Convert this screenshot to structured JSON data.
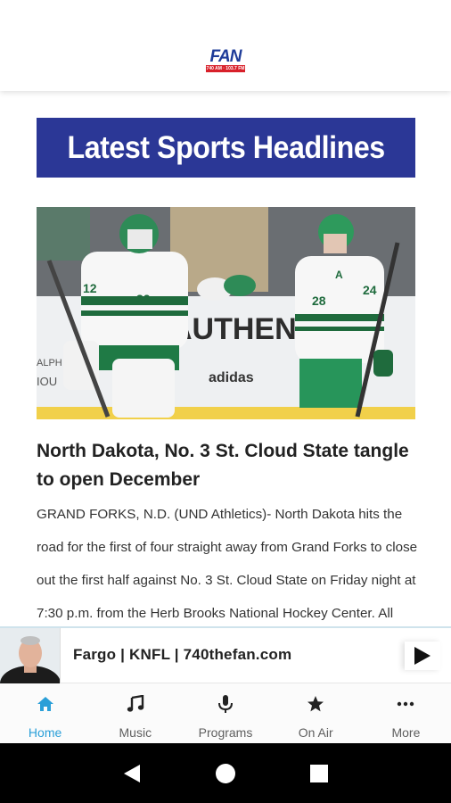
{
  "header": {
    "logo_text": "FAN",
    "logo_subtext": "740 AM · 103.7 FM",
    "logo_colors": {
      "blue": "#1f3c99",
      "red": "#d8202a"
    }
  },
  "banner": {
    "title": "Latest Sports Headlines",
    "background": "#2b3796"
  },
  "article": {
    "image_alt": "North Dakota hockey players celebrating",
    "title": "North Dakota, No. 3 St. Cloud State tangle to open December",
    "body": "GRAND FORKS, N.D. (UND Athletics)- North Dakota hits the road for the first of four straight away from Grand Forks to close out the first half against No. 3 St. Cloud State on Friday night at 7:30 p.m. from the Herb Brooks National Hockey Center. All"
  },
  "player": {
    "station": "Fargo | KNFL | 740thefan.com",
    "play_icon": "play-icon"
  },
  "tabs": [
    {
      "label": "Home",
      "icon": "home-icon",
      "active": true
    },
    {
      "label": "Music",
      "icon": "music-note-icon",
      "active": false
    },
    {
      "label": "Programs",
      "icon": "microphone-icon",
      "active": false
    },
    {
      "label": "On Air",
      "icon": "star-icon",
      "active": false
    },
    {
      "label": "More",
      "icon": "more-dots-icon",
      "active": false
    }
  ],
  "colors": {
    "accent": "#2a9fd8",
    "tab_inactive": "#5f5f5f"
  }
}
